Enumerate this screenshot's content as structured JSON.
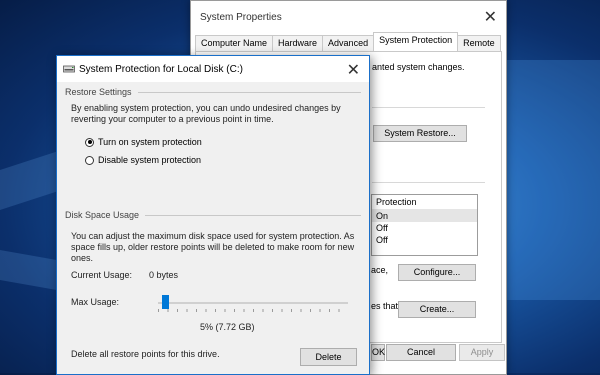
{
  "system_properties": {
    "title": "System Properties",
    "close_glyph": "✕",
    "tabs": [
      "Computer Name",
      "Hardware",
      "Advanced",
      "System Protection",
      "Remote"
    ],
    "active_tab": "System Protection",
    "partial_text_1": "anted system changes.",
    "system_restore_label": "System Restore...",
    "list_header": "Protection",
    "list_rows": [
      "On",
      "Off",
      "Off"
    ],
    "partial_text_2": "ace,",
    "configure_label": "Configure...",
    "partial_text_3": "es that",
    "create_label": "Create...",
    "ok_label": "OK",
    "cancel_label": "Cancel",
    "apply_label": "Apply"
  },
  "dialog": {
    "title": "System Protection for Local Disk (C:)",
    "close_glyph": "✕",
    "restore_settings_heading": "Restore Settings",
    "restore_description": "By enabling system protection, you can undo undesired changes by reverting your computer to a previous point in time.",
    "radio_on_label": "Turn on system protection",
    "radio_off_label": "Disable system protection",
    "radio_selected": "on",
    "disk_space_heading": "Disk Space Usage",
    "disk_space_description": "You can adjust the maximum disk space used for system protection. As space fills up, older restore points will be deleted to make room for new ones.",
    "current_usage_label": "Current Usage:",
    "current_usage_value": "0 bytes",
    "max_usage_label": "Max Usage:",
    "max_usage_percent": 5,
    "max_usage_text": "5% (7.72 GB)",
    "delete_description": "Delete all restore points for this drive.",
    "delete_label": "Delete"
  },
  "colors": {
    "accent": "#0078d7",
    "desktop": "#1a5aa8"
  },
  "icons": {
    "dialog_icon": "drive-icon",
    "close": "close-icon"
  }
}
